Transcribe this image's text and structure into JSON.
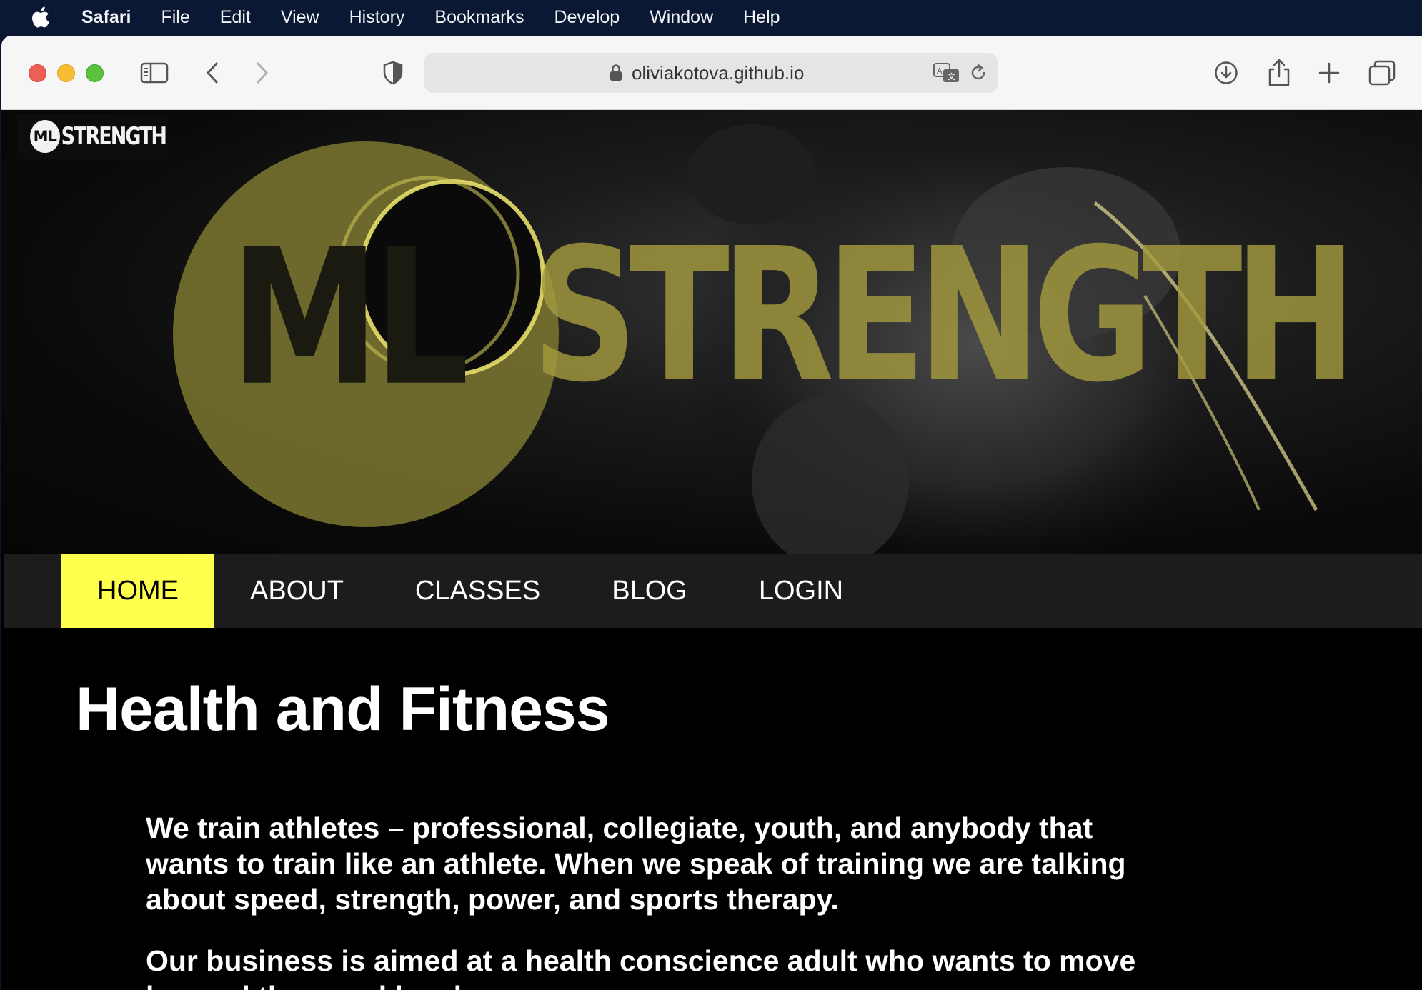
{
  "menubar": {
    "app": "Safari",
    "items": [
      "File",
      "Edit",
      "View",
      "History",
      "Bookmarks",
      "Develop",
      "Window",
      "Help"
    ]
  },
  "browser": {
    "url": "oliviakotova.github.io"
  },
  "site": {
    "logo": {
      "mark": "ML",
      "word": "STRENGTH"
    },
    "hero": {
      "mark": "ML",
      "word": "STRENGTH"
    },
    "nav": [
      "HOME",
      "ABOUT",
      "CLASSES",
      "BLOG",
      "LOGIN"
    ],
    "active_nav": "HOME",
    "heading": "Health and Fitness",
    "paragraphs": [
      "We train athletes – professional, collegiate, youth, and anybody that wants to train like an athlete. When we speak of training we are talking about speed, strength, power, and sports therapy.",
      "Our business is aimed at a health conscience adult who wants to move beyond the usual local gym."
    ]
  },
  "colors": {
    "accent": "#ffff4d",
    "hero_text": "#a39a3e",
    "nav_bg": "#1c1c1c"
  }
}
